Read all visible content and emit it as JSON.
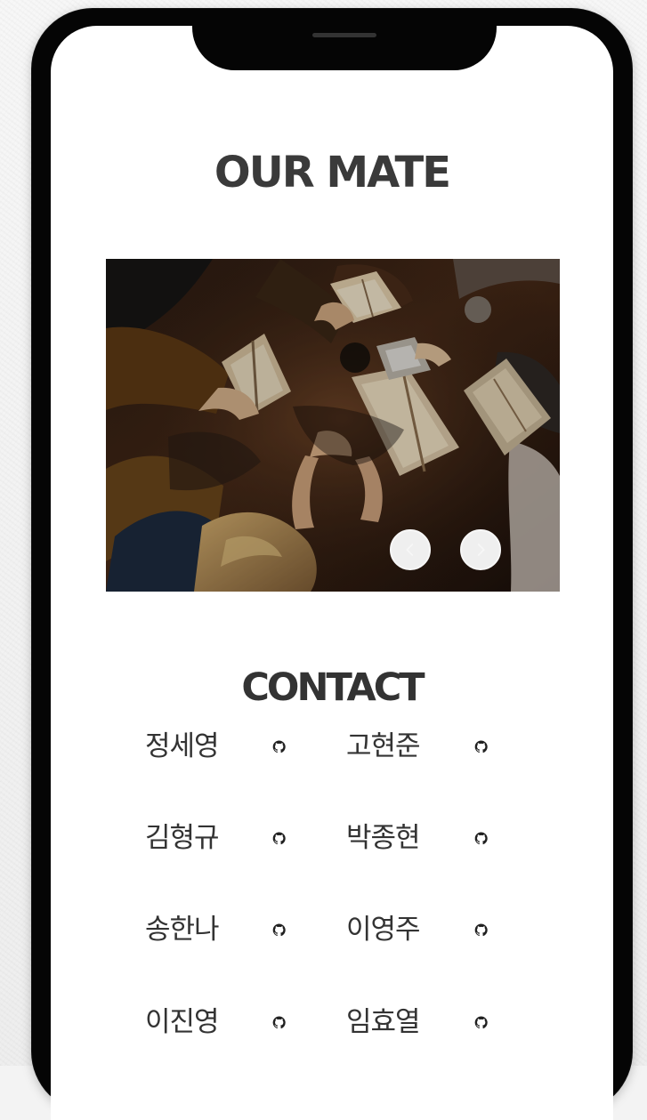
{
  "sections": {
    "our_mate_title": "OUR MATE",
    "contact_title": "CONTACT"
  },
  "slider": {
    "image_alt": "People reading books around a wooden table",
    "prev_label": "Previous slide",
    "next_label": "Next slide"
  },
  "contacts": [
    {
      "name": "정세영",
      "link_icon": "github-icon"
    },
    {
      "name": "고현준",
      "link_icon": "github-icon"
    },
    {
      "name": "김형규",
      "link_icon": "github-icon"
    },
    {
      "name": "박종현",
      "link_icon": "github-icon"
    },
    {
      "name": "송한나",
      "link_icon": "github-icon"
    },
    {
      "name": "이영주",
      "link_icon": "github-icon"
    },
    {
      "name": "이진영",
      "link_icon": "github-icon"
    },
    {
      "name": "임효열",
      "link_icon": "github-icon"
    }
  ],
  "colors": {
    "background": "#f3f3f3",
    "phone_frame": "#050505",
    "screen": "#ffffff",
    "heading": "#3a3a3a",
    "text": "#333333",
    "slider_button": "#f7f7f7"
  },
  "icons": {
    "slider_prev": "chevron-left-icon",
    "slider_next": "chevron-right-icon",
    "contact_link": "github-icon"
  }
}
